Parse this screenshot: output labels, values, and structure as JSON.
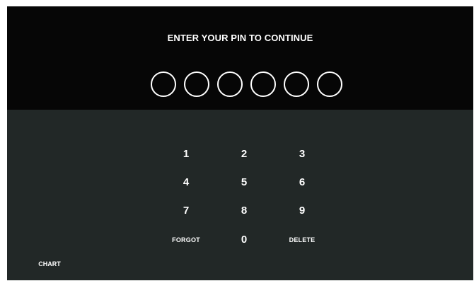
{
  "header": {
    "prompt": "ENTER YOUR PIN TO CONTINUE",
    "pin_length": 6,
    "pin_filled": 0
  },
  "keypad": {
    "k1": "1",
    "k2": "2",
    "k3": "3",
    "k4": "4",
    "k5": "5",
    "k6": "6",
    "k7": "7",
    "k8": "8",
    "k9": "9",
    "forgot": "FORGOT",
    "k0": "0",
    "delete": "DELETE"
  },
  "footer": {
    "chart_label": "CHART"
  },
  "colors": {
    "header_bg": "#060606",
    "body_bg": "#222827",
    "text": "#ffffff"
  }
}
